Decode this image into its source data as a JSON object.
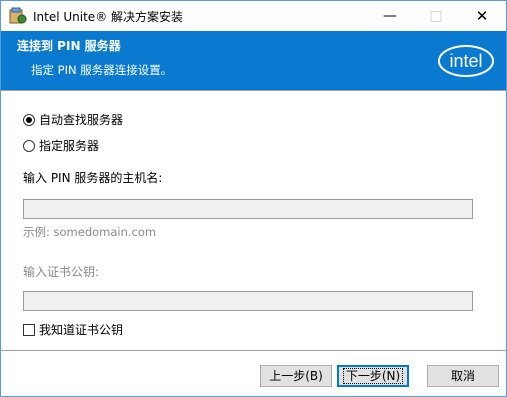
{
  "window": {
    "title": "Intel Unite® 解决方案安装",
    "minimize": "—",
    "maximize": "□",
    "close": "✕"
  },
  "header": {
    "title": "连接到 PIN 服务器",
    "subtitle": "指定 PIN 服务器连接设置。",
    "logo_text": "intel",
    "brand_color": "#0a79d0"
  },
  "options": {
    "auto_find": {
      "label": "自动查找服务器",
      "checked": true
    },
    "specify": {
      "label": "指定服务器",
      "checked": false
    }
  },
  "host": {
    "label": "输入 PIN 服务器的主机名:",
    "value": "",
    "example": "示例: somedomain.com"
  },
  "cert": {
    "label": "输入证书公钥:",
    "value": ""
  },
  "know_cert": {
    "label": "我知道证书公钥",
    "checked": false
  },
  "buttons": {
    "back": "上一步(B)",
    "next": "下一步(N)",
    "cancel": "取消"
  }
}
